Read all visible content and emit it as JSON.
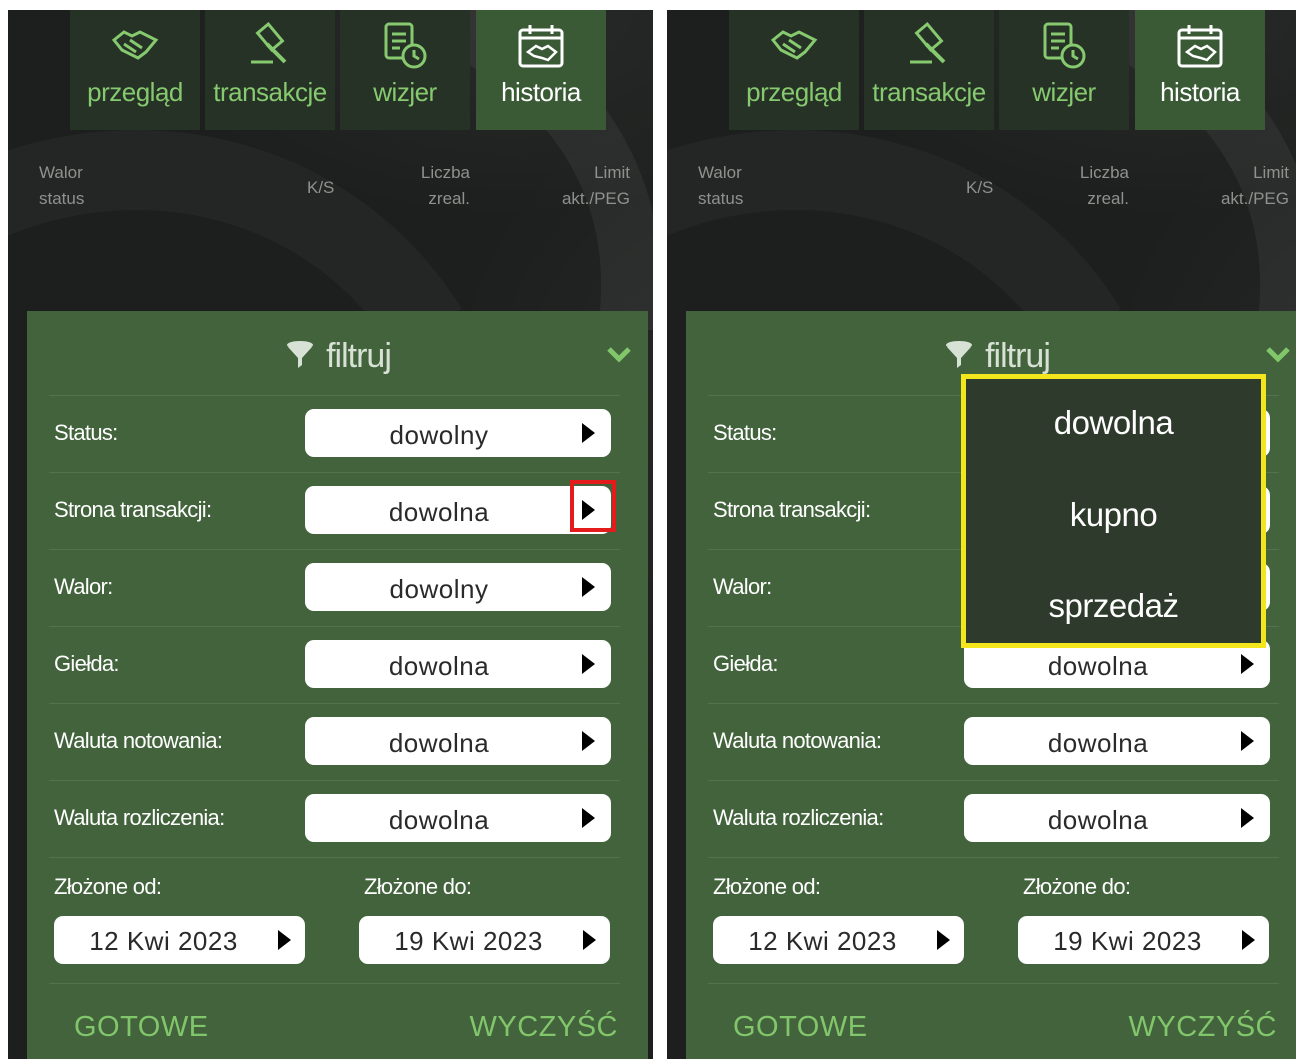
{
  "tabs": [
    {
      "label": "przegląd",
      "icon": "handshake-icon"
    },
    {
      "label": "transakcje",
      "icon": "gavel-icon"
    },
    {
      "label": "wizjer",
      "icon": "document-clock-icon"
    },
    {
      "label": "historia",
      "icon": "calendar-handshake-icon",
      "active": true
    }
  ],
  "table_header": {
    "walor": "Walor",
    "status": "status",
    "ks": "K/S",
    "liczba": "Liczba",
    "zreal": "zreal.",
    "limit": "Limit",
    "akt_peg": "akt./PEG"
  },
  "filter": {
    "title": "filtruj",
    "rows": [
      {
        "label": "Status:",
        "value": "dowolny"
      },
      {
        "label": "Strona transakcji:",
        "value": "dowolna"
      },
      {
        "label": "Walor:",
        "value": "dowolny"
      },
      {
        "label": "Giełda:",
        "value": "dowolna"
      },
      {
        "label": "Waluta notowania:",
        "value": "dowolna"
      },
      {
        "label": "Waluta rozliczenia:",
        "value": "dowolna"
      }
    ],
    "from_label": "Złożone od:",
    "from_value": "12 Kwi 2023",
    "to_label": "Złożone do:",
    "to_value": "19 Kwi 2023",
    "done": "GOTOWE",
    "clear": "WYCZYŚĆ"
  },
  "dropdown": {
    "options": [
      "dowolna",
      "kupno",
      "sprzedaż"
    ]
  },
  "colors": {
    "background": "#1d1f1e",
    "filter_panel": "#42633c",
    "accent_green": "#82c66c",
    "highlight_red": "#e41b1b",
    "highlight_yellow": "#f3e61d"
  }
}
